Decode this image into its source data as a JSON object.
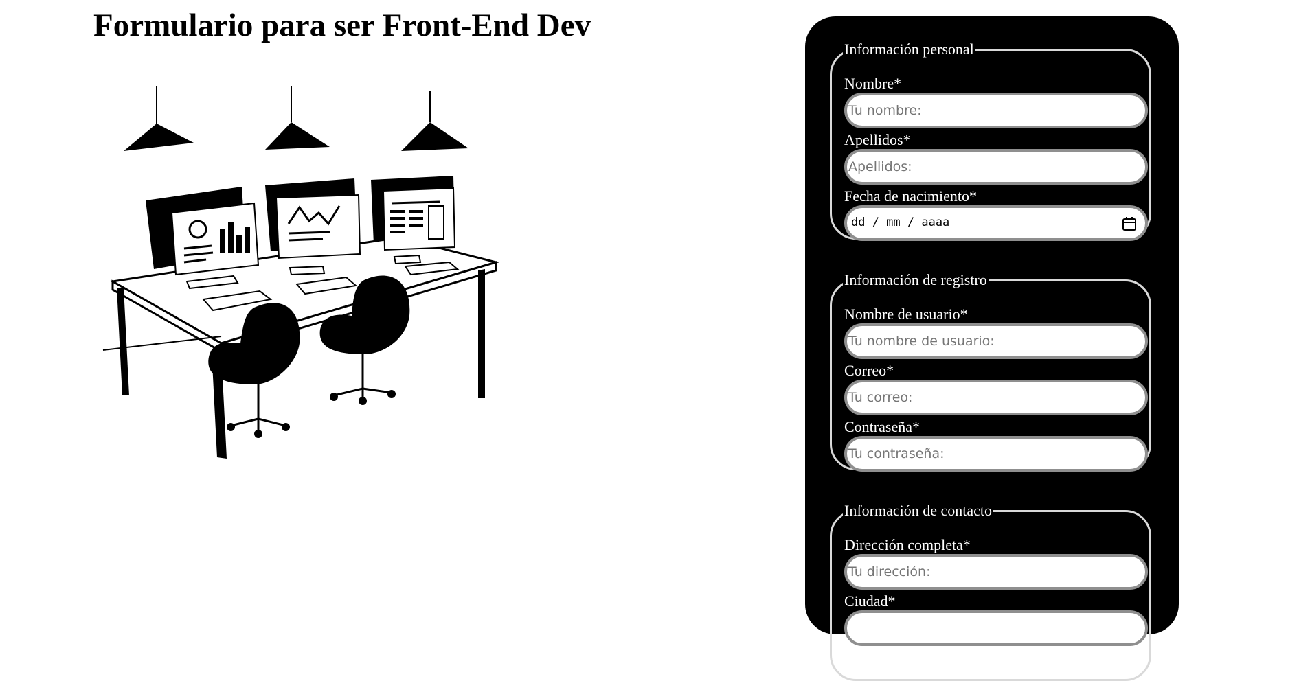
{
  "page": {
    "title": "Formulario para ser Front-End Dev"
  },
  "illustration": {
    "icon": "office-desk-illustration"
  },
  "form": {
    "personal": {
      "legend": "Información personal",
      "nombre": {
        "label": "Nombre*",
        "placeholder": "Tu nombre:"
      },
      "apellidos": {
        "label": "Apellidos*",
        "placeholder": "Apellidos:"
      },
      "fecha": {
        "label": "Fecha de nacimiento*",
        "value": "dd / mm / aaaa",
        "icon": "calendar-icon"
      }
    },
    "registro": {
      "legend": "Información de registro",
      "usuario": {
        "label": "Nombre de usuario*",
        "placeholder": "Tu nombre de usuario:"
      },
      "correo": {
        "label": "Correo*",
        "placeholder": "Tu correo:"
      },
      "contrasena": {
        "label": "Contraseña*",
        "placeholder": "Tu contraseña:"
      }
    },
    "contacto": {
      "legend": "Información de contacto",
      "direccion": {
        "label": "Dirección completa*",
        "placeholder": "Tu dirección:"
      },
      "ciudad": {
        "label": "Ciudad*"
      }
    }
  },
  "colors": {
    "panel": "#000000",
    "field_border": "#8f8f8f",
    "fieldset_border": "#d9d9d9"
  }
}
